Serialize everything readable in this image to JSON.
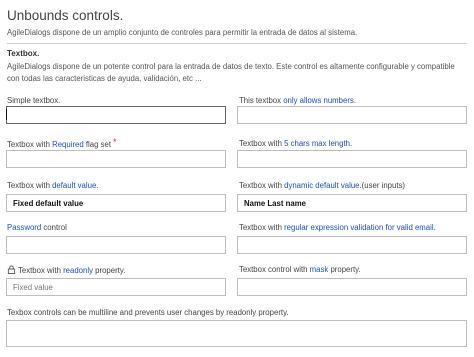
{
  "page": {
    "title": "Unbounds controls.",
    "description": "AgileDialogs dispone de un amplio conjunto de controles para permitir la entrada de datos al sistema."
  },
  "section": {
    "title": "Textbox.",
    "description": "AgileDialogs dispone de un potente control para la entrada de datos de texto. Este control es altamente configurable y compatible con todas las caracteristicas de ayuda, validación, etc ..."
  },
  "fields": {
    "simple": {
      "label": "Simple textbox.",
      "value": ""
    },
    "numbers": {
      "label_pre": "This textbox ",
      "label_hl": "only allows numbers",
      "label_post": ".",
      "value": ""
    },
    "required": {
      "label_pre": "Textbox with ",
      "label_hl": "Required",
      "label_post": " flag set",
      "required_mark": "*",
      "value": ""
    },
    "maxlength": {
      "label_pre": "Textbox with ",
      "label_hl": "5 chars max length",
      "label_post": ".",
      "value": ""
    },
    "default": {
      "label_pre": "Textbox with ",
      "label_hl": "default value",
      "label_post": ".",
      "value": "Fixed default value"
    },
    "dynamic": {
      "label_pre": "Textbox with ",
      "label_hl": "dynamic default value",
      "label_post": ".(user inputs)",
      "value": "Name Last name"
    },
    "password": {
      "label_hl": "Password",
      "label_post": " control",
      "value": ""
    },
    "regex": {
      "label_pre": "Textbox with ",
      "label_hl": "regular expression validation for valid email",
      "label_post": ".",
      "value": ""
    },
    "readonly": {
      "label_pre": "Textbox with ",
      "label_hl": "readonly",
      "label_post": " property.",
      "value": "Fixed value",
      "icon": "lock-icon"
    },
    "mask": {
      "label_pre": "Textbox control with ",
      "label_hl": "mask",
      "label_post": " property.",
      "value": ""
    },
    "multiline": {
      "label": "Texbox controls can be multiline and prevents user changes by readonly property.",
      "value": ""
    }
  },
  "colors": {
    "highlight": "#1f4fb0",
    "required": "#dd2222",
    "border": "#bdbdbd"
  }
}
